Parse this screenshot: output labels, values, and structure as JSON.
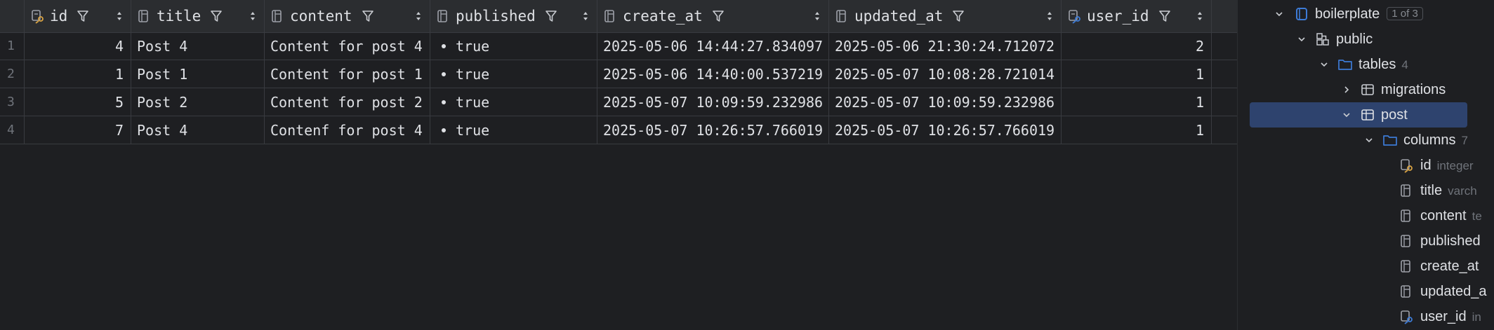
{
  "grid": {
    "columns": [
      {
        "name": "id",
        "icon": "key-column-icon"
      },
      {
        "name": "title",
        "icon": "column-icon"
      },
      {
        "name": "content",
        "icon": "column-icon"
      },
      {
        "name": "published",
        "icon": "column-icon"
      },
      {
        "name": "create_at",
        "icon": "column-icon"
      },
      {
        "name": "updated_at",
        "icon": "column-icon"
      },
      {
        "name": "user_id",
        "icon": "foreign-key-column-icon"
      }
    ],
    "rows": [
      {
        "n": "1",
        "id": "4",
        "title": "Post 4",
        "content": "Content for post 4",
        "published": "true",
        "create_at": "2025-05-06 14:44:27.834097",
        "updated_at": "2025-05-06 21:30:24.712072",
        "user_id": "2"
      },
      {
        "n": "2",
        "id": "1",
        "title": "Post 1",
        "content": "Content for post 1",
        "published": "true",
        "create_at": "2025-05-06 14:40:00.537219",
        "updated_at": "2025-05-07 10:08:28.721014",
        "user_id": "1"
      },
      {
        "n": "3",
        "id": "5",
        "title": "Post 2",
        "content": "Content for post 2",
        "published": "true",
        "create_at": "2025-05-07 10:09:59.232986",
        "updated_at": "2025-05-07 10:09:59.232986",
        "user_id": "1"
      },
      {
        "n": "4",
        "id": "7",
        "title": "Post 4",
        "content": "Contenf for post 4",
        "published": "true",
        "create_at": "2025-05-07 10:26:57.766019",
        "updated_at": "2025-05-07 10:26:57.766019",
        "user_id": "1"
      }
    ]
  },
  "tree": {
    "database": {
      "label": "boilerplate",
      "badge": "1 of 3"
    },
    "schema": {
      "label": "public"
    },
    "tables": {
      "label": "tables",
      "count": "4"
    },
    "migrations": {
      "label": "migrations"
    },
    "post": {
      "label": "post"
    },
    "columns": {
      "label": "columns",
      "count": "7"
    },
    "column_items": [
      {
        "label": "id",
        "type": "integer"
      },
      {
        "label": "title",
        "type": "varch"
      },
      {
        "label": "content",
        "type": "te"
      },
      {
        "label": "published",
        "type": ""
      },
      {
        "label": "create_at",
        "type": ""
      },
      {
        "label": "updated_a",
        "type": ""
      },
      {
        "label": "user_id",
        "type": "in"
      }
    ]
  },
  "colors": {
    "background": "#1e1f22",
    "header": "#2b2d30",
    "selection": "#2e436e",
    "key_icon": "#d9a343",
    "fk_icon": "#3d7bd6"
  }
}
